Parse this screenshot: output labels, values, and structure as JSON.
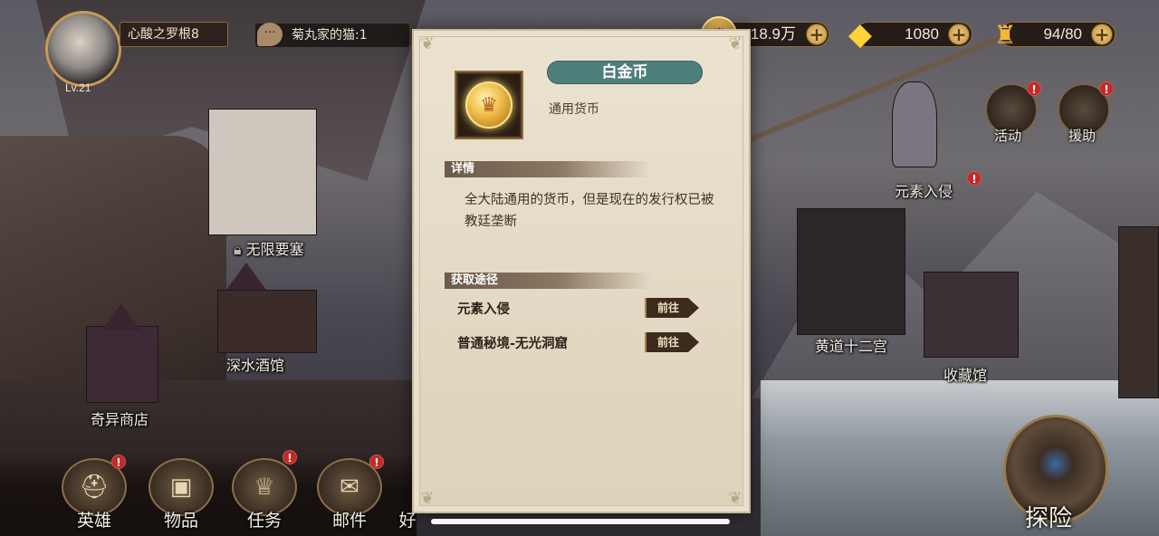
{
  "player": {
    "name": "心酸之罗根8",
    "level": "Lv.21",
    "chat_message": "菊丸家的猫:1"
  },
  "currencies": {
    "gold": {
      "value": "18.9万",
      "icon": "gold-coin-icon"
    },
    "diamond": {
      "value": "1080",
      "icon": "diamond-icon"
    },
    "stamina": {
      "value": "94/80",
      "icon": "stamina-icon"
    }
  },
  "map": {
    "locations": [
      {
        "label": "无限要塞"
      },
      {
        "label": "深水酒馆"
      },
      {
        "label": "奇异商店"
      },
      {
        "label": "元素入侵"
      },
      {
        "label": "黄道十二宫"
      },
      {
        "label": "收藏馆"
      }
    ],
    "side_buttons": [
      {
        "label": "活动"
      },
      {
        "label": "援助"
      }
    ],
    "alert_mark": "!"
  },
  "bottom_nav": [
    {
      "label": "英雄"
    },
    {
      "label": "物品"
    },
    {
      "label": "任务"
    },
    {
      "label": "邮件"
    },
    {
      "label": "好"
    }
  ],
  "explore_label": "探险",
  "item_panel": {
    "title": "白金币",
    "category": "通用货币",
    "detail_header": "详情",
    "detail_text": "全大陆通用的货币，但是现在的发行权已被教廷垄断",
    "source_header": "获取途径",
    "sources": [
      {
        "name": "元素入侵",
        "button": "前往"
      },
      {
        "name": "普通秘境-无光洞窟",
        "button": "前往"
      }
    ]
  },
  "colors": {
    "title_banner": "#4e7f7a",
    "panel_bg": "#e8dfcc",
    "alert": "#c22a26",
    "accent_gold": "#c79a55"
  }
}
